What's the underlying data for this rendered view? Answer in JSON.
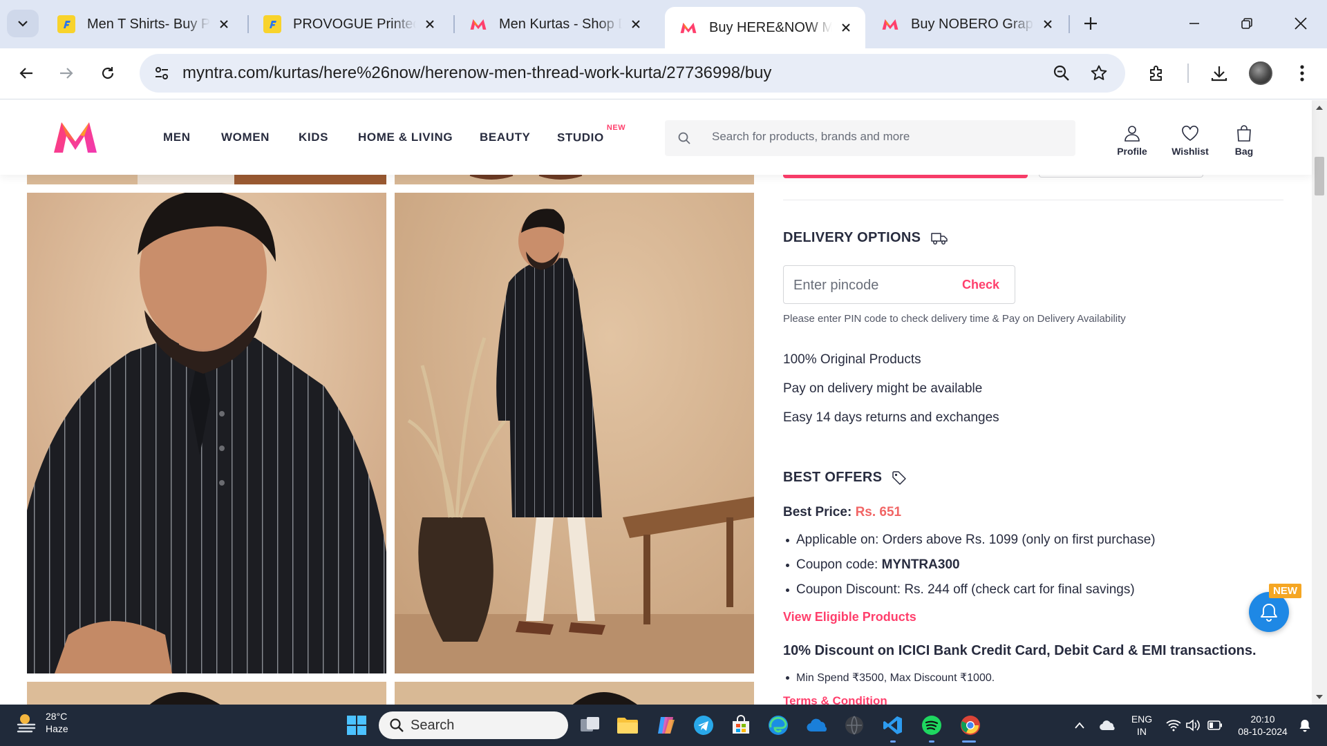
{
  "browser": {
    "tabs": [
      {
        "title": "Men T Shirts- Buy Printed",
        "favicon": "flipkart-icon"
      },
      {
        "title": "PROVOGUE Printed Men",
        "favicon": "flipkart-icon"
      },
      {
        "title": "Men Kurtas - Shop Designer",
        "favicon": "myntra-icon"
      },
      {
        "title": "Buy HERE&NOW Men",
        "favicon": "myntra-icon"
      },
      {
        "title": "Buy NOBERO Graphic",
        "favicon": "myntra-icon"
      }
    ],
    "url": "myntra.com/kurtas/here%26now/herenow-men-thread-work-kurta/27736998/buy"
  },
  "header": {
    "nav": [
      "MEN",
      "WOMEN",
      "KIDS",
      "HOME & LIVING",
      "BEAUTY",
      "STUDIO"
    ],
    "studio_badge": "NEW",
    "search_placeholder": "Search for products, brands and more",
    "actions": {
      "profile": "Profile",
      "wishlist": "Wishlist",
      "bag": "Bag"
    }
  },
  "delivery": {
    "title": "DELIVERY OPTIONS",
    "pincode_placeholder": "Enter pincode",
    "check_label": "Check",
    "note": "Please enter PIN code to check delivery time & Pay on Delivery Availability",
    "features": [
      "100% Original Products",
      "Pay on delivery might be available",
      "Easy 14 days returns and exchanges"
    ]
  },
  "offers": {
    "title": "BEST OFFERS",
    "best_price_label": "Best Price:",
    "best_price_value": "Rs. 651",
    "bullets": {
      "applicable": "Applicable on: Orders above Rs. 1099 (only on first purchase)",
      "coupon_prefix": "Coupon code:",
      "coupon_code": "MYNTRA300",
      "discount": "Coupon Discount: Rs. 244 off (check cart for final savings)"
    },
    "view_eligible": "View Eligible Products",
    "bank_offer_title": "10% Discount on ICICI Bank Credit Card, Debit Card & EMI transactions.",
    "bank_offer_detail": "Min Spend ₹3500, Max Discount ₹1000.",
    "terms": "Terms & Condition"
  },
  "notification": {
    "badge": "NEW"
  },
  "taskbar": {
    "weather_temp": "28°C",
    "weather_desc": "Haze",
    "search": "Search",
    "lang_1": "ENG",
    "lang_2": "IN",
    "time": "20:10",
    "date": "08-10-2024"
  },
  "colors": {
    "brand_pink": "#ff3f6c",
    "price_orange": "#f16565",
    "notif_blue": "#1e88e5"
  }
}
